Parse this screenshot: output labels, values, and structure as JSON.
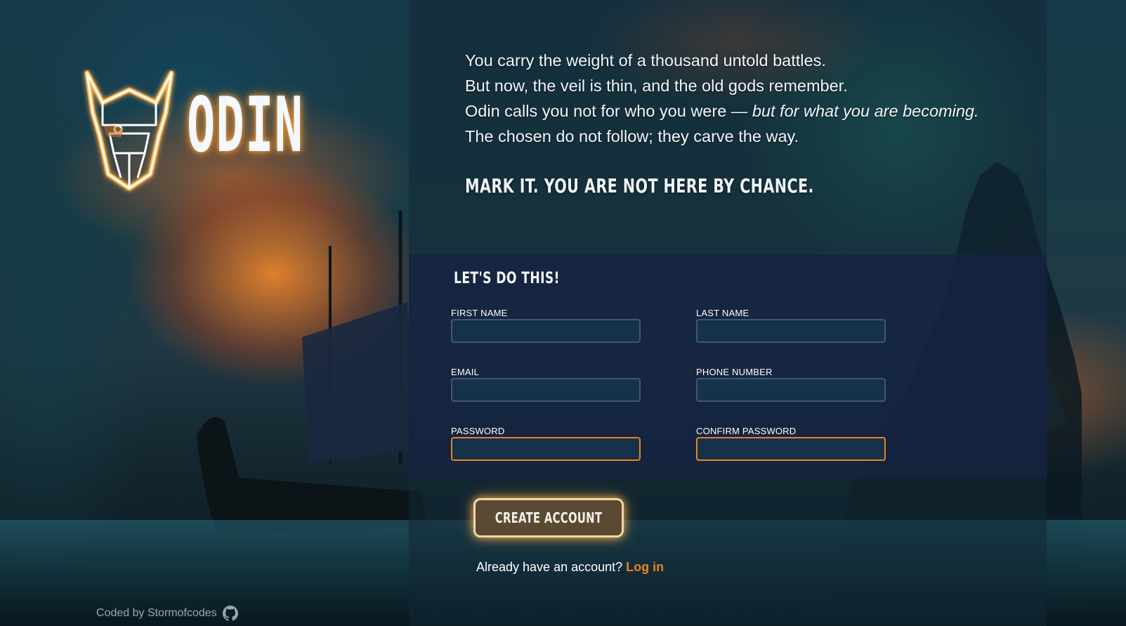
{
  "brand": {
    "name": "ODIN",
    "glow_color": "#ffaa3c",
    "icon": "viking-helmet-icon"
  },
  "intro": {
    "lines": [
      "You carry the weight of a thousand untold battles.",
      "But now, the veil is thin, and the old gods remember."
    ],
    "line3_plain": "Odin calls you not for who you were — ",
    "line3_italic": "but for what you are becoming.",
    "line4": "The chosen do not follow; they carve the way.",
    "tagline": "MARK IT. YOU ARE NOT HERE BY CHANCE."
  },
  "form": {
    "heading": "LET'S DO THIS!",
    "fields": {
      "first_name": {
        "label": "FIRST NAME",
        "value": ""
      },
      "last_name": {
        "label": "LAST NAME",
        "value": ""
      },
      "email": {
        "label": "EMAIL",
        "value": ""
      },
      "phone": {
        "label": "PHONE NUMBER",
        "value": ""
      },
      "password": {
        "label": "PASSWORD",
        "value": ""
      },
      "confirm_password": {
        "label": "CONFIRM PASSWORD",
        "value": ""
      }
    },
    "submit_label": "CREATE ACCOUNT"
  },
  "login": {
    "prompt": "Already have an account?",
    "link_label": "Log in"
  },
  "footer": {
    "credit": "Coded by Stormofcodes",
    "icon": "github-icon"
  },
  "colors": {
    "accent": "#e8841f",
    "input_bg": "#16324a",
    "input_border": "#3c5a73",
    "form_bg": "#16224280"
  }
}
